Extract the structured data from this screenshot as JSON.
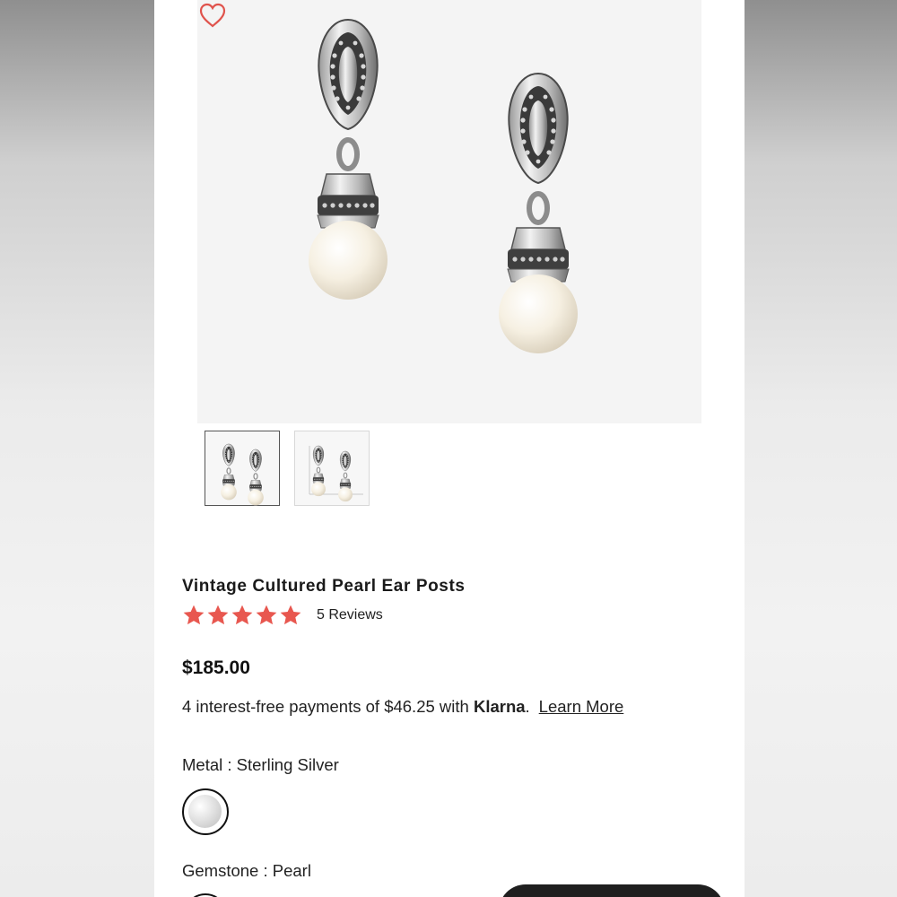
{
  "product": {
    "title": "Vintage Cultured Pearl Ear Posts",
    "rating_stars": 5,
    "reviews_label": "5 Reviews",
    "price": "$185.00",
    "klarna": {
      "prefix": "4 interest-free payments of $46.25 with ",
      "brand": "Klarna",
      "suffix": ".",
      "learn_more": "Learn More"
    },
    "metal_label": "Metal : Sterling Silver",
    "gemstone_label": "Gemstone : Pearl"
  },
  "gallery": {
    "thumbnails": [
      "product-front",
      "product-with-ruler"
    ],
    "selected_index": 0
  },
  "icons": {
    "favorite": "heart-outline-icon",
    "star": "star-filled-icon"
  },
  "colors": {
    "star": "#e8574f",
    "heart": "#e0534c",
    "text": "#222222"
  }
}
